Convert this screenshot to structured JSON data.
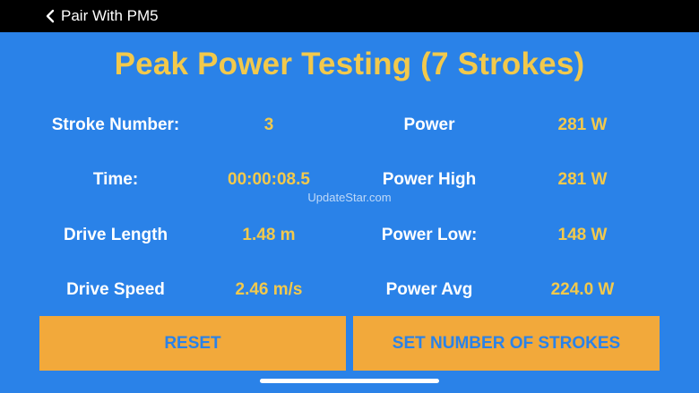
{
  "topbar": {
    "back_label": "Pair With PM5"
  },
  "title": "Peak Power Testing (7 Strokes)",
  "left_stats": [
    {
      "label": "Stroke Number:",
      "value": "3"
    },
    {
      "label": "Time:",
      "value": "00:00:08.5"
    },
    {
      "label": "Drive Length",
      "value": "1.48 m"
    },
    {
      "label": "Drive Speed",
      "value": "2.46 m/s"
    }
  ],
  "right_stats": [
    {
      "label": "Power",
      "value": "281 W"
    },
    {
      "label": "Power High",
      "value": "281 W"
    },
    {
      "label": "Power Low:",
      "value": "148 W"
    },
    {
      "label": "Power Avg",
      "value": "224.0 W"
    }
  ],
  "watermark": "UpdateStar.com",
  "buttons": {
    "reset": "RESET",
    "set_strokes": "SET NUMBER OF STROKES"
  },
  "colors": {
    "background": "#2a82e8",
    "accent": "#f2c94c",
    "button": "#f2a93b",
    "topbar": "#000000"
  }
}
